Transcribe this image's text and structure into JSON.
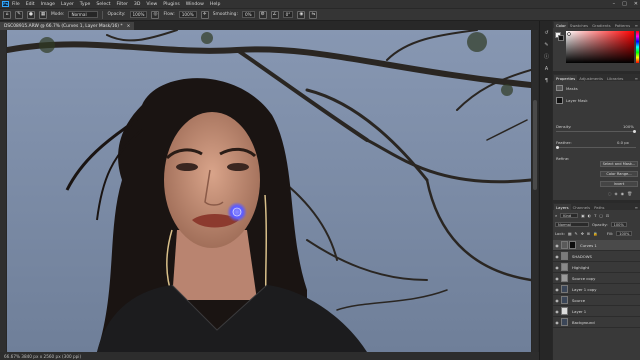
{
  "menu": {
    "logo": "Ps",
    "items": [
      "File",
      "Edit",
      "Image",
      "Layer",
      "Type",
      "Select",
      "Filter",
      "3D",
      "View",
      "Plugins",
      "Window",
      "Help"
    ],
    "window_controls": [
      "–",
      "□",
      "✕"
    ]
  },
  "options": {
    "mode_label": "Mode:",
    "mode_value": "Normal",
    "opacity_label": "Opacity:",
    "opacity_value": "100%",
    "flow_label": "Flow:",
    "flow_value": "100%",
    "smoothing_label": "Smoothing:",
    "smoothing_value": "0%",
    "angle_value": "0°"
  },
  "document": {
    "tab_title": "DSC08915.ARW @ 66.7% (Curves 1, Layer Mask/16) *",
    "tab_close": "×",
    "status": "66.67%   3840 px x 2560 px (300 ppi)"
  },
  "panels": {
    "color_tabs": [
      "Color",
      "Swatches",
      "Gradients",
      "Patterns"
    ],
    "properties_tabs": [
      "Properties",
      "Adjustments",
      "Libraries"
    ],
    "properties": {
      "masks_label": "Masks",
      "layer_mask_label": "Layer Mask",
      "density_label": "Density:",
      "density_value": "100%",
      "feather_label": "Feather:",
      "feather_value": "0.0 px",
      "refine_label": "Refine:",
      "select_mask_btn": "Select and Mask...",
      "color_range_btn": "Color Range...",
      "invert_btn": "Invert"
    },
    "layers_tabs": [
      "Layers",
      "Channels",
      "Paths"
    ],
    "layers": {
      "kind_label": "Kind",
      "blend_mode": "Normal",
      "opacity_label": "Opacity:",
      "opacity_value": "100%",
      "lock_label": "Lock:",
      "fill_label": "Fill:",
      "fill_value": "100%",
      "rows": [
        {
          "name": "Curves 1",
          "selected": true
        },
        {
          "name": "SHADOWS",
          "selected": false
        },
        {
          "name": "Highlight",
          "selected": false
        },
        {
          "name": "Source copy",
          "selected": false
        },
        {
          "name": "Layer 1 copy",
          "selected": false
        },
        {
          "name": "Source",
          "selected": false
        },
        {
          "name": "Layer 1",
          "selected": false
        },
        {
          "name": "Background",
          "selected": false
        }
      ]
    }
  },
  "colors": {
    "accent": "#31a8ff",
    "brush_cursor": "#5b5bff"
  }
}
